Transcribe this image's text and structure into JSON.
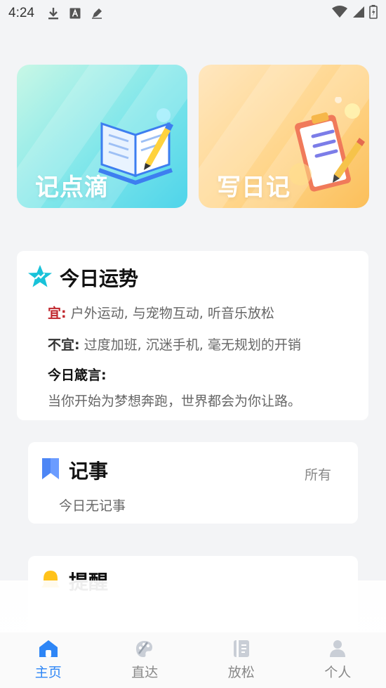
{
  "status": {
    "time": "4:24",
    "left_icons": [
      "download-icon",
      "a-badge-icon",
      "edit-pencil-icon"
    ],
    "right_icons": [
      "wifi-icon",
      "cellular-icon",
      "battery-icon"
    ]
  },
  "top_cards": {
    "note": {
      "label": "记点滴",
      "icon": "open-book-pen-icon"
    },
    "diary": {
      "label": "写日记",
      "icon": "clipboard-pencil-icon"
    }
  },
  "fortune": {
    "title": "今日运势",
    "icon": "star-icon",
    "good_label": "宜:",
    "good_text": "户外运动, 与宠物互动, 听音乐放松",
    "bad_label": "不宜:",
    "bad_text": "过度加班, 沉迷手机, 毫无规划的开销",
    "motto_label": "今日箴言:",
    "motto_text": "当你开始为梦想奔跑，世界都会为你让路。"
  },
  "notes": {
    "title": "记事",
    "icon": "bookmark-icon",
    "all_label": "所有",
    "empty_text": "今日无记事"
  },
  "reminder": {
    "title": "提醒",
    "icon": "bell-icon"
  },
  "nav": [
    {
      "label": "主页",
      "icon": "home-icon",
      "active": true
    },
    {
      "label": "直达",
      "icon": "palette-icon",
      "active": false
    },
    {
      "label": "放松",
      "icon": "notebook-icon",
      "active": false
    },
    {
      "label": "个人",
      "icon": "person-icon",
      "active": false
    }
  ],
  "colors": {
    "accent": "#2e86f6",
    "good": "#c0272d",
    "star": "#18c2d9"
  }
}
